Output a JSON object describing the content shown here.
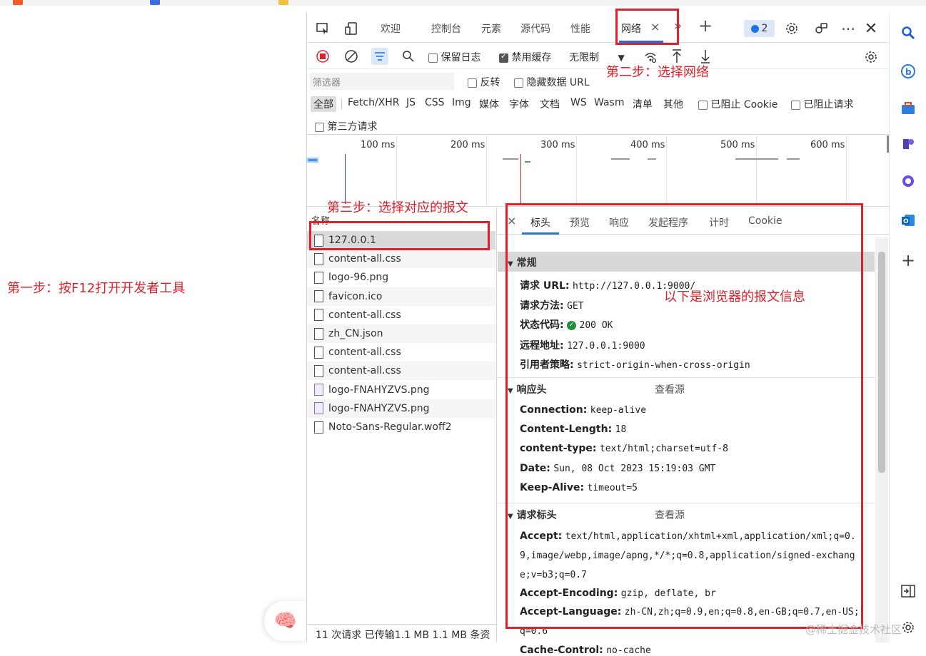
{
  "annotations": {
    "step1": "第一步：按F12打开开发者工具",
    "step2": "第二步：选择网络",
    "step3": "第三步：选择对应的报文",
    "info": "以下是浏览器的报文信息"
  },
  "devtools": {
    "tabs": [
      "欢迎",
      "控制台",
      "元素",
      "源代码",
      "性能",
      "网络"
    ],
    "active_tab_close": "×",
    "more_tabs": "»",
    "add_tab": "+",
    "issues_count": "2",
    "toolbar": {
      "preserve_log": "保留日志",
      "disable_cache": "禁用缓存",
      "throttle": "无限制"
    },
    "filter": {
      "placeholder": "筛选器",
      "invert": "反转",
      "hide_data_urls": "隐藏数据 URL"
    },
    "types": [
      "全部",
      "Fetch/XHR",
      "JS",
      "CSS",
      "Img",
      "媒体",
      "字体",
      "文档",
      "WS",
      "Wasm",
      "清单",
      "其他"
    ],
    "blocked_cookies": "已阻止 Cookie",
    "blocked_requests": "已阻止请求",
    "third_party": "第三方请求",
    "timeline_ticks": [
      "100 ms",
      "200 ms",
      "300 ms",
      "400 ms",
      "500 ms",
      "600 ms"
    ],
    "request_list": {
      "header": "名称",
      "items": [
        {
          "name": "127.0.0.1",
          "kind": "doc"
        },
        {
          "name": "content-all.css",
          "kind": "doc"
        },
        {
          "name": "logo-96.png",
          "kind": "doc"
        },
        {
          "name": "favicon.ico",
          "kind": "doc"
        },
        {
          "name": "content-all.css",
          "kind": "doc"
        },
        {
          "name": "zh_CN.json",
          "kind": "doc"
        },
        {
          "name": "content-all.css",
          "kind": "doc"
        },
        {
          "name": "content-all.css",
          "kind": "doc"
        },
        {
          "name": "logo-FNAHYZVS.png",
          "kind": "img"
        },
        {
          "name": "logo-FNAHYZVS.png",
          "kind": "img"
        },
        {
          "name": "Noto-Sans-Regular.woff2",
          "kind": "doc"
        }
      ],
      "status": "11 次请求  已传输1.1 MB  1.1 MB 条资"
    },
    "detail": {
      "close": "×",
      "tabs": [
        "标头",
        "预览",
        "响应",
        "发起程序",
        "计时",
        "Cookie"
      ],
      "general": {
        "title": "常规",
        "request_url_k": "请求 URL:",
        "request_url_v": "http://127.0.0.1:9000/",
        "method_k": "请求方法:",
        "method_v": "GET",
        "status_k": "状态代码:",
        "status_v": "200 OK",
        "remote_k": "远程地址:",
        "remote_v": "127.0.0.1:9000",
        "referrer_k": "引用者策略:",
        "referrer_v": "strict-origin-when-cross-origin"
      },
      "response_headers": {
        "title": "响应头",
        "view_source": "查看源",
        "items": [
          {
            "k": "Connection:",
            "v": "keep-alive"
          },
          {
            "k": "Content-Length:",
            "v": "18"
          },
          {
            "k": "content-type:",
            "v": "text/html;charset=utf-8"
          },
          {
            "k": "Date:",
            "v": "Sun, 08 Oct 2023 15:19:03 GMT"
          },
          {
            "k": "Keep-Alive:",
            "v": "timeout=5"
          }
        ]
      },
      "request_headers": {
        "title": "请求标头",
        "view_source": "查看源",
        "accept_k": "Accept:",
        "accept_v": "text/html,application/xhtml+xml,application/xml;q=0.9,image/webp,image/apng,*/*;q=0.8,application/signed-exchange;v=b3;q=0.7",
        "encoding_k": "Accept-Encoding:",
        "encoding_v": "gzip, deflate, br",
        "language_k": "Accept-Language:",
        "language_v": "zh-CN,zh;q=0.9,en;q=0.8,en-GB;q=0.7,en-US;q=0.6",
        "cache_k": "Cache-Control:",
        "cache_v": "no-cache"
      }
    }
  },
  "watermark": "@稀土掘金技术社区",
  "colors": {
    "annotation": "#e0202a",
    "accent": "#1a73e8"
  }
}
